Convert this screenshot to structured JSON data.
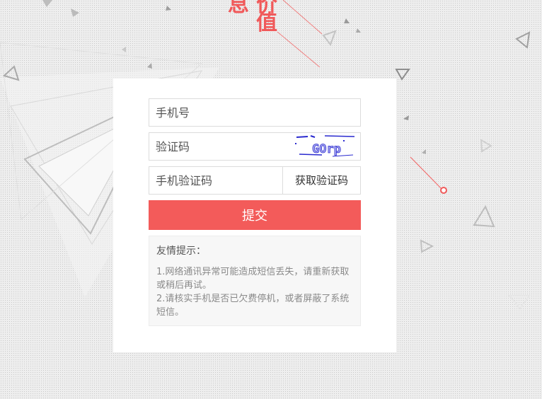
{
  "hero": {
    "char1": "息",
    "char2": "价",
    "char3": "值"
  },
  "form": {
    "phone_placeholder": "手机号",
    "captcha_placeholder": "验证码",
    "captcha_text": "GOrp",
    "sms_placeholder": "手机验证码",
    "sms_button_label": "获取验证码",
    "submit_label": "提交"
  },
  "tips": {
    "title": "友情提示：",
    "line1": "1.网络通讯异常可能造成短信丢失，请重新获取或稍后再试。",
    "line2": "2.请核实手机是否已欠费停机，或者屏蔽了系统短信。"
  },
  "colors": {
    "accent": "#f35b5a",
    "background": "#eeeeee",
    "card": "#ffffff"
  }
}
